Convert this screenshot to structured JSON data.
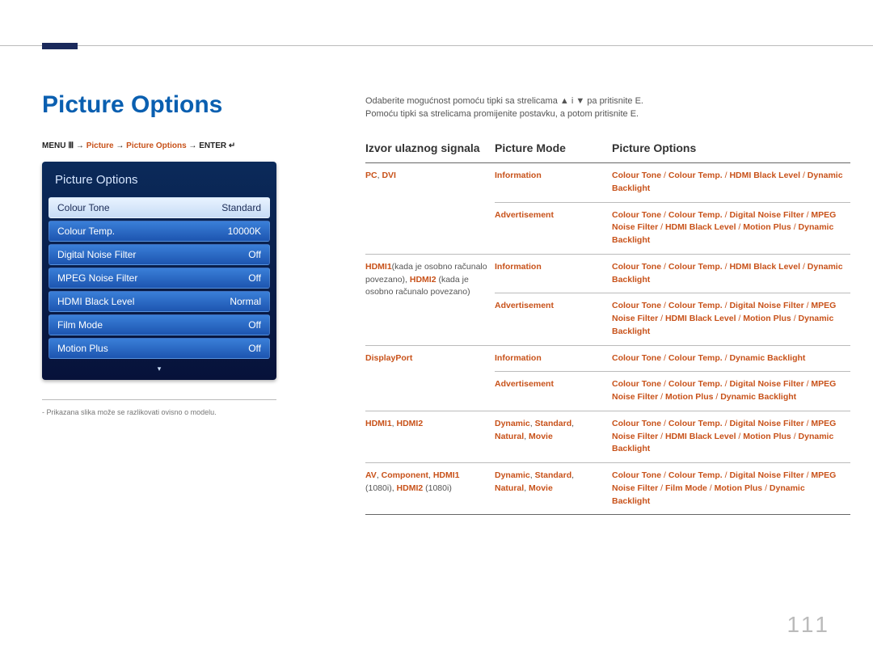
{
  "title": "Picture Options",
  "breadcrumb": {
    "menu": "MENU",
    "arrow1": "→",
    "p1": "Picture",
    "arrow2": "→",
    "p2": "Picture Options",
    "arrow3": "→",
    "enter": "ENTER"
  },
  "osd": {
    "title": "Picture Options",
    "rows": [
      {
        "label": "Colour Tone",
        "value": "Standard",
        "selected": true
      },
      {
        "label": "Colour Temp.",
        "value": "10000K",
        "selected": false
      },
      {
        "label": "Digital Noise Filter",
        "value": "Off",
        "selected": false
      },
      {
        "label": "MPEG Noise Filter",
        "value": "Off",
        "selected": false
      },
      {
        "label": "HDMI Black Level",
        "value": "Normal",
        "selected": false
      },
      {
        "label": "Film Mode",
        "value": "Off",
        "selected": false
      },
      {
        "label": "Motion Plus",
        "value": "Off",
        "selected": false
      }
    ],
    "more": "▾"
  },
  "footnote": "- Prikazana slika može se razlikovati ovisno o modelu.",
  "desc1": "Odaberite mogućnost pomoću tipki sa strelicama ▲ i ▼ pa pritisnite E.",
  "desc2": "Pomoću tipki sa strelicama promijenite postavku, a potom pritisnite E.",
  "table": {
    "headers": [
      "Izvor ulaznog signala",
      "Picture Mode",
      "Picture Options"
    ],
    "rows": [
      {
        "src": [
          {
            "t": "PC",
            "hl": true
          },
          {
            "t": ", ",
            "hl": false
          },
          {
            "t": "DVI",
            "hl": true
          }
        ],
        "mode": [
          {
            "t": "Information",
            "hl": true
          }
        ],
        "opts": "Colour Tone / Colour Temp. / HDMI Black Level / Dynamic Backlight",
        "rowspan_src": 1
      },
      {
        "src": null,
        "mode": [
          {
            "t": "Advertisement",
            "hl": true
          }
        ],
        "opts": "Colour Tone / Colour Temp. / Digital Noise Filter / MPEG Noise Filter / HDMI Black Level / Motion Plus / Dynamic Backlight"
      },
      {
        "src_html": "<span class='hl'>HDMI1</span><span class='plain'>(kada je osobno računalo povezano), </span><span class='hl'>HDMI2</span> <span class='plain'>(kada je osobno računalo povezano)</span>",
        "mode": [
          {
            "t": "Information",
            "hl": true
          }
        ],
        "opts": "Colour Tone / Colour Temp. / HDMI Black Level / Dynamic Backlight",
        "rowspan_src": 2
      },
      {
        "src": null,
        "mode": [
          {
            "t": "Advertisement",
            "hl": true
          }
        ],
        "opts": "Colour Tone / Colour Temp. / Digital Noise Filter / MPEG Noise Filter / HDMI Black Level / Motion Plus / Dynamic Backlight"
      },
      {
        "src": [
          {
            "t": "DisplayPort",
            "hl": true
          }
        ],
        "mode": [
          {
            "t": "Information",
            "hl": true
          }
        ],
        "opts": "Colour Tone / Colour Temp. / Dynamic Backlight",
        "rowspan_src": 2
      },
      {
        "src": null,
        "mode": [
          {
            "t": "Advertisement",
            "hl": true
          }
        ],
        "opts": "Colour Tone / Colour Temp. / Digital Noise Filter / MPEG Noise Filter / Motion Plus / Dynamic Backlight"
      },
      {
        "src": [
          {
            "t": "HDMI1",
            "hl": true
          },
          {
            "t": ", ",
            "hl": false
          },
          {
            "t": "HDMI2",
            "hl": true
          }
        ],
        "mode_html": "<span class='hl'>Dynamic</span>, <span class='hl'>Standard</span>, <span class='hl'>Natural</span>, <span class='hl'>Movie</span>",
        "opts": "Colour Tone / Colour Temp. / Digital Noise Filter / MPEG Noise Filter / HDMI Black Level / Motion Plus / Dynamic Backlight"
      },
      {
        "src_html": "<span class='hl'>AV</span>, <span class='hl'>Component</span>, <span class='hl'>HDMI1</span> <span class='plain'>(1080i)</span>, <span class='hl'>HDMI2</span> <span class='plain'>(1080i)</span>",
        "mode_html": "<span class='hl'>Dynamic</span>, <span class='hl'>Standard</span>, <span class='hl'>Natural</span>, <span class='hl'>Movie</span>",
        "opts": "Colour Tone / Colour Temp. / Digital Noise Filter / MPEG Noise Filter / Film Mode / Motion Plus / Dynamic Backlight",
        "last": true
      }
    ]
  },
  "page_number": "111"
}
